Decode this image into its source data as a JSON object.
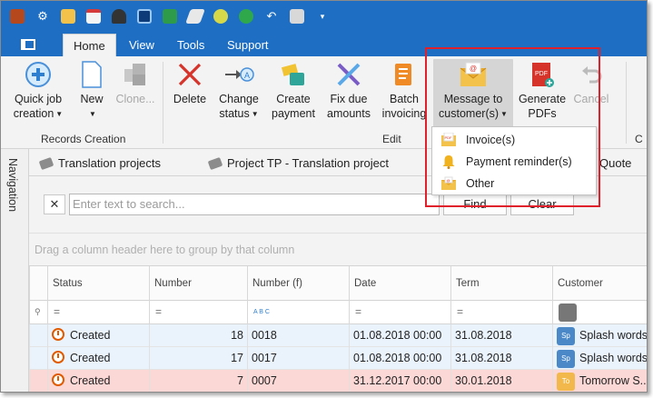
{
  "ribbon_tabs": [
    "Home",
    "View",
    "Tools",
    "Support"
  ],
  "ribbon": {
    "quick_job_creation": "Quick job creation",
    "new": "New",
    "clone": "Clone...",
    "records_creation_group": "Records Creation",
    "delete": "Delete",
    "change_status": "Change status",
    "create_payment": "Create payment",
    "fix_due_amounts": "Fix due amounts",
    "batch_invoicing": "Batch invoicing",
    "message_to_customers": "Message to customer(s)",
    "generate_pdfs": "Generate PDFs",
    "cancel": "Cancel",
    "edit_group": "Edit",
    "edge_group_fragment": "C"
  },
  "dropdown": {
    "items": [
      "Invoice(s)",
      "Payment reminder(s)",
      "Other"
    ]
  },
  "navigation_label": "Navigation",
  "doc_tabs": [
    "Translation projects",
    "Project TP - Translation project",
    "Quote"
  ],
  "search": {
    "clear_x": "✕",
    "placeholder": "Enter text to search...",
    "find": "Find",
    "clear": "Clear"
  },
  "group_by_hint": "Drag a column header here to group by that column",
  "grid": {
    "columns": [
      "Status",
      "Number",
      "Number (f)",
      "Date",
      "Term",
      "Customer"
    ],
    "filter_symbols": [
      "=",
      "=",
      "A B C",
      "=",
      "=",
      ""
    ],
    "rows": [
      {
        "status": "Created",
        "number": "18",
        "number_f": "0018",
        "date": "01.08.2018 00:00",
        "term": "31.08.2018",
        "customer_badge": "Sp",
        "customer": "Splash words"
      },
      {
        "status": "Created",
        "number": "17",
        "number_f": "0017",
        "date": "01.08.2018 00:00",
        "term": "31.08.2018",
        "customer_badge": "Sp",
        "customer": "Splash words"
      },
      {
        "status": "Created",
        "number": "7",
        "number_f": "0007",
        "date": "31.12.2017 00:00",
        "term": "30.01.2018",
        "customer_badge": "To",
        "customer": "Tomorrow S..."
      }
    ]
  },
  "colors": {
    "title_blue": "#1e6fc4",
    "highlight_red": "#e0202a",
    "row_blue": "#eaf3fc",
    "row_red": "#fbd8d6"
  }
}
